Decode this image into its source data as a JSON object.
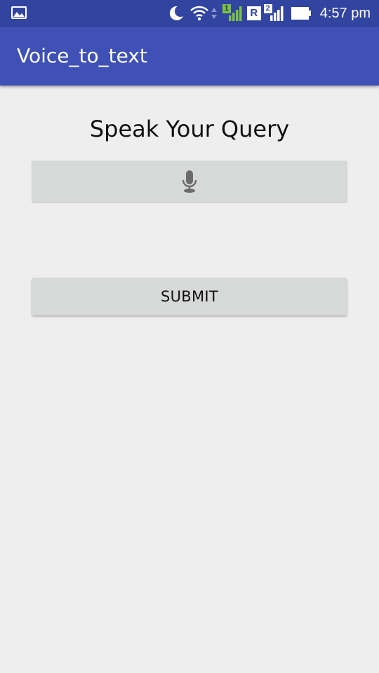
{
  "status_bar": {
    "time": "4:57 pm",
    "sim1_label": "1",
    "sim2_label": "2",
    "roaming_label": "R",
    "icons": [
      "gallery-icon",
      "moon-icon",
      "wifi-icon",
      "data-arrows-icon",
      "signal-sim1-icon",
      "roaming-icon",
      "signal-sim2-icon",
      "battery-icon"
    ],
    "colors": {
      "background": "#3144a0",
      "sim1_accent": "#7cc242"
    }
  },
  "app_bar": {
    "title": "Voice_to_text",
    "color": "#3f51b5"
  },
  "main": {
    "heading": "Speak Your Query",
    "mic_button_icon": "microphone-icon",
    "submit_label": "SUBMIT",
    "button_color": "#d7d8d8",
    "background": "#eeeeee"
  }
}
